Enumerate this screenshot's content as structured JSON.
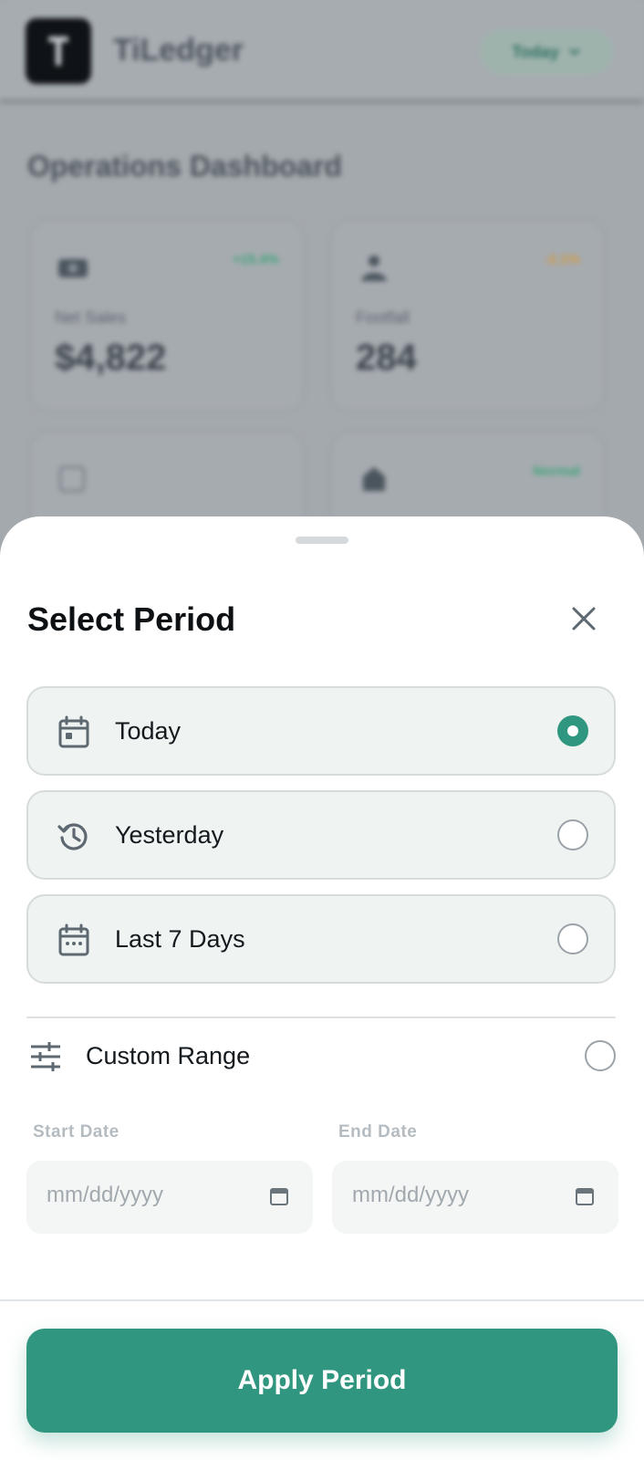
{
  "background": {
    "brand": "TiLedger",
    "period_pill": "Today",
    "page_title": "Operations Dashboard",
    "cards": [
      {
        "label": "Net Sales",
        "value": "$4,822",
        "delta": "+15.4%",
        "delta_color": "#3fa479",
        "icon": "cash-icon"
      },
      {
        "label": "Footfall",
        "value": "284",
        "delta": "-2.1%",
        "delta_color": "#d39a3c",
        "icon": "people-icon"
      },
      {
        "label": "",
        "value": "",
        "delta": "",
        "delta_color": "#3fa479",
        "icon": "box-icon"
      },
      {
        "label": "",
        "value": "",
        "delta": "Normal",
        "delta_color": "#3fa479",
        "icon": "store-icon"
      }
    ]
  },
  "sheet": {
    "title": "Select Period",
    "options": [
      {
        "label": "Today",
        "icon": "calendar-today-icon",
        "selected": true
      },
      {
        "label": "Yesterday",
        "icon": "history-icon",
        "selected": false
      },
      {
        "label": "Last 7 Days",
        "icon": "calendar-week-icon",
        "selected": false
      }
    ],
    "custom": {
      "label": "Custom Range",
      "icon": "sliders-icon",
      "selected": false
    },
    "start_date": {
      "label": "Start Date",
      "placeholder": "mm/dd/yyyy"
    },
    "end_date": {
      "label": "End Date",
      "placeholder": "mm/dd/yyyy"
    },
    "apply_label": "Apply Period"
  },
  "colors": {
    "accent": "#31967f",
    "icon": "#5d6870"
  }
}
